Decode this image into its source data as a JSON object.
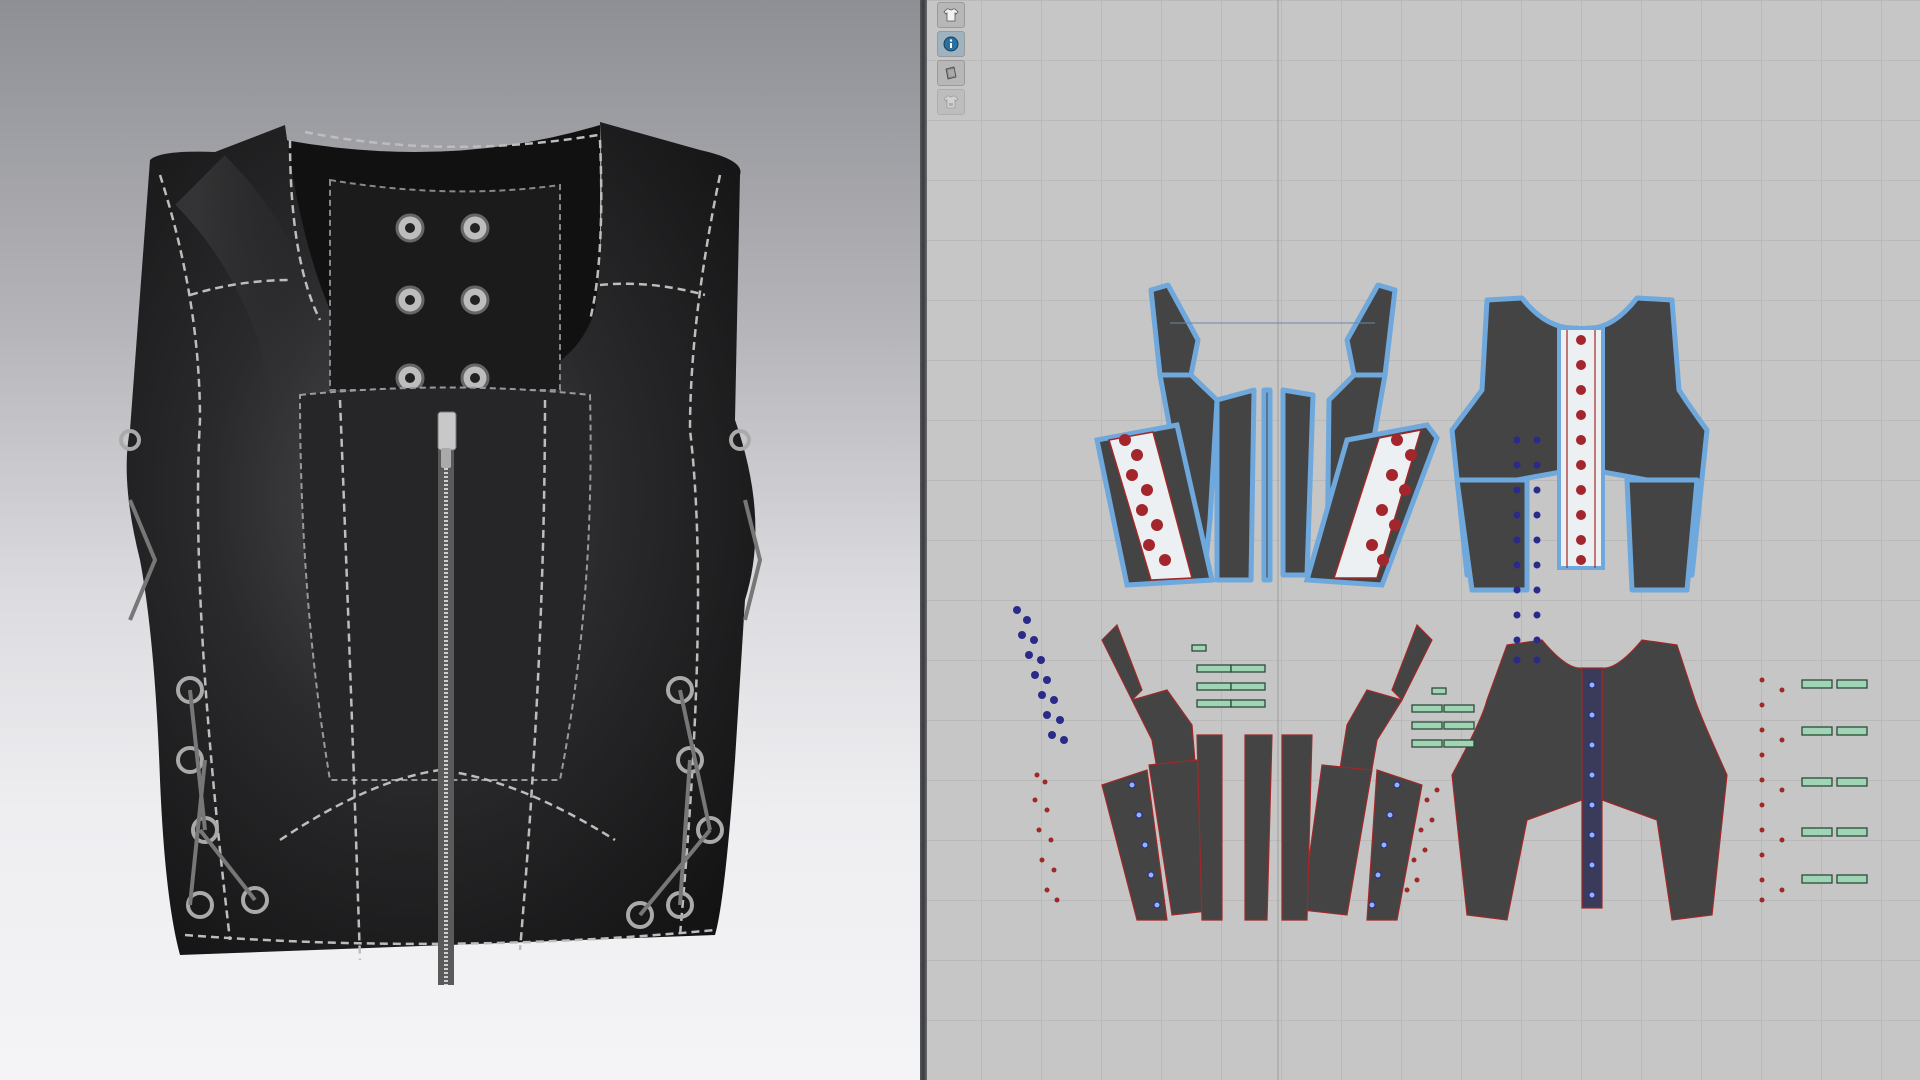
{
  "app": {
    "panels": [
      "3d-garment-view",
      "2d-pattern-view"
    ]
  },
  "toolbar": {
    "tools": [
      {
        "icon": "avatar-shirt-icon",
        "active": false
      },
      {
        "icon": "info-icon",
        "active": true
      },
      {
        "icon": "fabric-layers-icon",
        "active": false
      },
      {
        "icon": "lock-shirt-icon",
        "active": false
      }
    ]
  },
  "colors": {
    "panel_bg_2d": "#c6c6c6",
    "pattern_fill": "#444444",
    "selected_outline": "#6ea8dc",
    "seam_red": "#a02828",
    "button_red": "#a3262d",
    "button_blue": "#2a2a8a",
    "trim_green": "#9fd5b4",
    "leather": "#1e1e1e",
    "stitch": "#bdbdbd"
  }
}
